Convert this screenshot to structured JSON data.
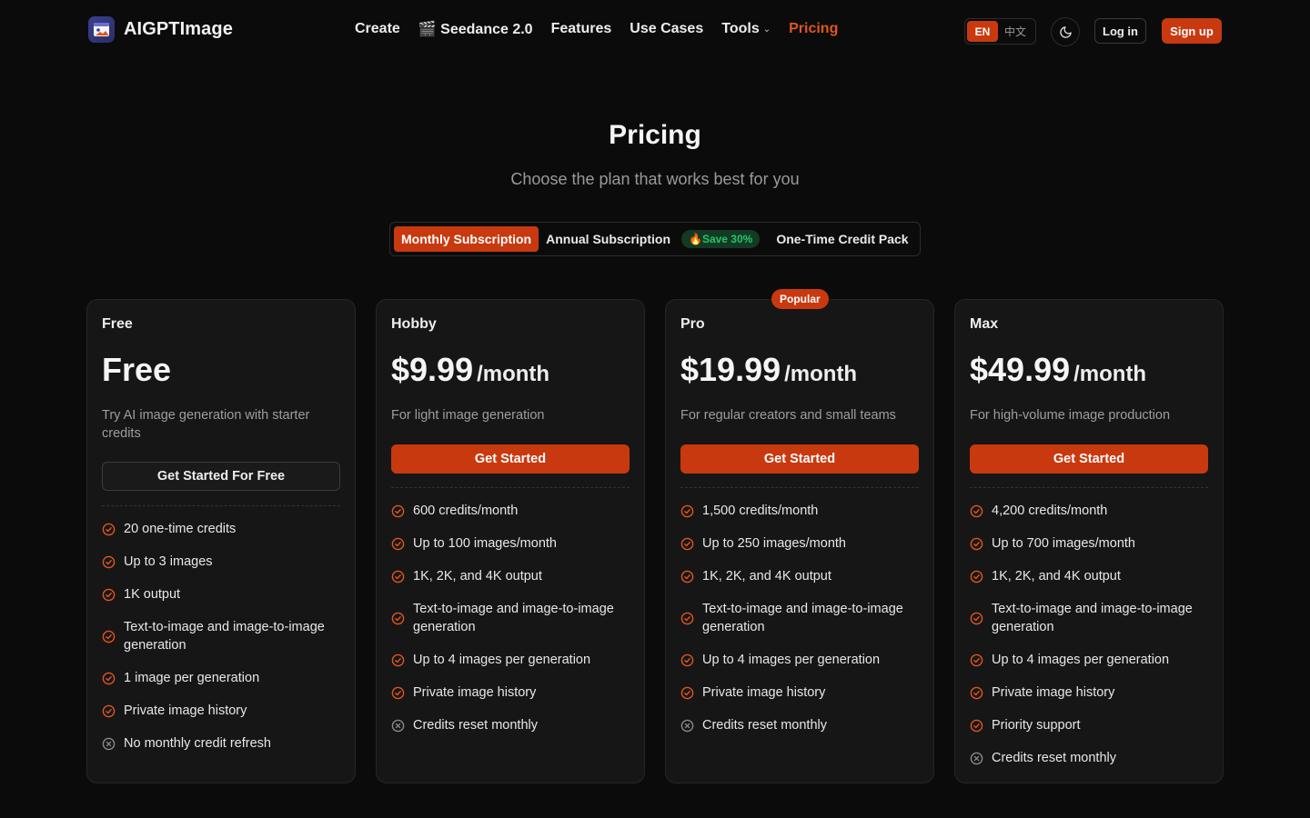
{
  "brand": {
    "name": "AIGPTImage",
    "accent": "#c9390f"
  },
  "nav": {
    "items": [
      {
        "label": "Create",
        "name": "nav-create"
      },
      {
        "label": "🎬 Seedance 2.0",
        "name": "nav-seedance"
      },
      {
        "label": "Features",
        "name": "nav-features"
      },
      {
        "label": "Use Cases",
        "name": "nav-use-cases"
      },
      {
        "label": "Tools",
        "name": "nav-tools"
      },
      {
        "label": "Pricing",
        "name": "nav-pricing"
      }
    ]
  },
  "header": {
    "lang_en": "EN",
    "lang_zh": "中文",
    "login": "Log in",
    "signup": "Sign up",
    "theme_icon": "moon-icon"
  },
  "hero": {
    "title": "Pricing",
    "subtitle": "Choose the plan that works best for you"
  },
  "billing_tabs": {
    "monthly": "Monthly Subscription",
    "annual": "Annual Subscription",
    "save_badge": "🔥Save 30%",
    "one_time": "One-Time Credit Pack",
    "selected": "Monthly Subscription"
  },
  "plans": [
    {
      "name": "Free",
      "price": "Free",
      "period": "",
      "description": "Try AI image generation with starter credits",
      "cta": "Get Started For Free",
      "badge": "",
      "features": [
        {
          "text": "20 one-time credits",
          "included": true
        },
        {
          "text": "Up to 3 images",
          "included": true
        },
        {
          "text": "1K output",
          "included": true
        },
        {
          "text": "Text-to-image and image-to-image generation",
          "included": true
        },
        {
          "text": "1 image per generation",
          "included": true
        },
        {
          "text": "Private image history",
          "included": true
        },
        {
          "text": "No monthly credit refresh",
          "included": false
        }
      ]
    },
    {
      "name": "Hobby",
      "price": "$9.99",
      "period": "/month",
      "description": "For light image generation",
      "cta": "Get Started",
      "badge": "",
      "features": [
        {
          "text": "600 credits/month",
          "included": true
        },
        {
          "text": "Up to 100 images/month",
          "included": true
        },
        {
          "text": "1K, 2K, and 4K output",
          "included": true
        },
        {
          "text": "Text-to-image and image-to-image generation",
          "included": true
        },
        {
          "text": "Up to 4 images per generation",
          "included": true
        },
        {
          "text": "Private image history",
          "included": true
        },
        {
          "text": "Credits reset monthly",
          "included": false
        }
      ]
    },
    {
      "name": "Pro",
      "price": "$19.99",
      "period": "/month",
      "description": "For regular creators and small teams",
      "cta": "Get Started",
      "badge": "Popular",
      "features": [
        {
          "text": "1,500 credits/month",
          "included": true
        },
        {
          "text": "Up to 250 images/month",
          "included": true
        },
        {
          "text": "1K, 2K, and 4K output",
          "included": true
        },
        {
          "text": "Text-to-image and image-to-image generation",
          "included": true
        },
        {
          "text": "Up to 4 images per generation",
          "included": true
        },
        {
          "text": "Private image history",
          "included": true
        },
        {
          "text": "Credits reset monthly",
          "included": false
        }
      ]
    },
    {
      "name": "Max",
      "price": "$49.99",
      "period": "/month",
      "description": "For high-volume image production",
      "cta": "Get Started",
      "badge": "",
      "features": [
        {
          "text": "4,200 credits/month",
          "included": true
        },
        {
          "text": "Up to 700 images/month",
          "included": true
        },
        {
          "text": "1K, 2K, and 4K output",
          "included": true
        },
        {
          "text": "Text-to-image and image-to-image generation",
          "included": true
        },
        {
          "text": "Up to 4 images per generation",
          "included": true
        },
        {
          "text": "Private image history",
          "included": true
        },
        {
          "text": "Priority support",
          "included": true
        },
        {
          "text": "Credits reset monthly",
          "included": false
        }
      ]
    }
  ]
}
